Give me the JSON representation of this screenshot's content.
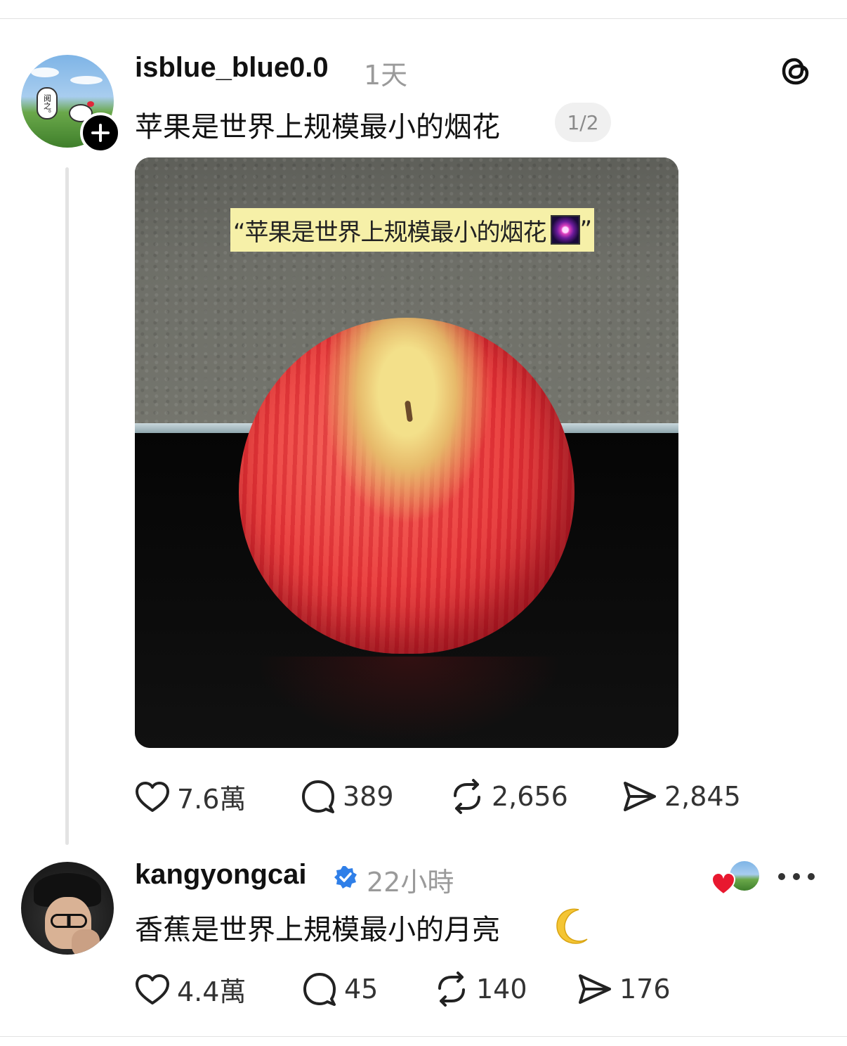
{
  "posts": [
    {
      "username": "isblue_blue0.0",
      "time": "1天",
      "text": "苹果是世界上规模最小的烟花",
      "page_indicator": "1/2",
      "avatar_bubble_text": "阅之。",
      "image_caption": "“苹果是世界上规模最小的烟花",
      "image_caption_end": "”",
      "image_emoji": "fireworks-emoji",
      "stats": {
        "likes": "7.6萬",
        "replies": "389",
        "reposts": "2,656",
        "shares": "2,845"
      }
    },
    {
      "username": "kangyongcai",
      "verified": true,
      "time": "22小時",
      "text": "香蕉是世界上規模最小的月亮",
      "emoji": "crescent-moon-emoji",
      "stats": {
        "likes": "4.4萬",
        "replies": "45",
        "reposts": "140",
        "shares": "176"
      }
    }
  ],
  "colors": {
    "verified_blue": "#2f7fe8",
    "heart_red": "#e8182f",
    "muted_text": "#9a9a9a"
  },
  "icons": [
    "threads-logo-icon",
    "follow-plus-icon",
    "heart-icon",
    "comment-icon",
    "repost-icon",
    "share-icon",
    "verified-badge-icon",
    "more-icon"
  ]
}
